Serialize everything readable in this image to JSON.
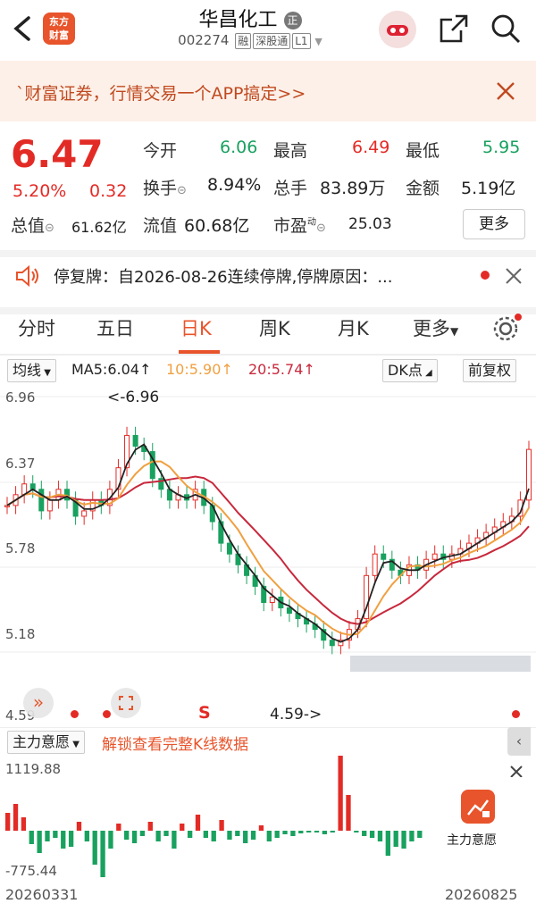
{
  "header": {
    "stock_name": "华昌化工",
    "badge": "正",
    "stock_code": "002274",
    "tags": [
      "融",
      "深股通",
      "L1"
    ],
    "logo_line1": "东方",
    "logo_line2": "财富"
  },
  "banner": {
    "text": "`财富证券，行情交易一个APP搞定>>"
  },
  "quote": {
    "price": "6.47",
    "change_pct": "5.20%",
    "change": "0.32",
    "rows": [
      [
        {
          "label": "今开",
          "value": "6.06",
          "color": "green"
        },
        {
          "label": "最高",
          "value": "6.49",
          "color": "red"
        },
        {
          "label": "最低",
          "value": "5.95",
          "color": "green"
        }
      ],
      [
        {
          "label": "换手",
          "value": "8.94%",
          "color": "dark"
        },
        {
          "label": "总手",
          "value": "83.89万",
          "color": "dark"
        },
        {
          "label": "金额",
          "value": "5.19亿",
          "color": "dark"
        }
      ]
    ],
    "total_value_label": "总值",
    "total_value": "61.62亿",
    "float_value_label": "流值",
    "float_value": "60.68亿",
    "pe_label": "市盈",
    "pe_super": "动",
    "pe_value": "25.03",
    "more_label": "更多"
  },
  "notice": {
    "text": "停复牌：自2026-08-26连续停牌,停牌原因：..."
  },
  "tabs": [
    "分时",
    "五日",
    "日K",
    "周K",
    "月K",
    "更多"
  ],
  "active_tab": "日K",
  "toolbar": {
    "indicator": "均线",
    "ma5": "MA5:6.04↑",
    "ma10": "10:5.90↑",
    "ma20": "20:5.74↑",
    "dk_label": "DK点",
    "adjust_label": "前复权"
  },
  "chart_labels": {
    "y_ticks": [
      "6.96",
      "6.37",
      "5.78",
      "5.18",
      "4.59"
    ],
    "high_annotation": "<-6.96",
    "low_annotation": "4.59->",
    "signal": "S"
  },
  "flow": {
    "indicator": "主力意愿",
    "lock_text": "解锁查看完整K线数据",
    "max": "1119.88",
    "min": "-775.44",
    "card_label": "主力意愿"
  },
  "dates": {
    "start": "20260331",
    "end": "20260825"
  },
  "colors": {
    "up": "#e32b26",
    "down": "#19a15f",
    "ma5": "#222222",
    "ma10": "#f0a040",
    "ma20": "#c8283c",
    "accent": "#e8542b"
  }
}
